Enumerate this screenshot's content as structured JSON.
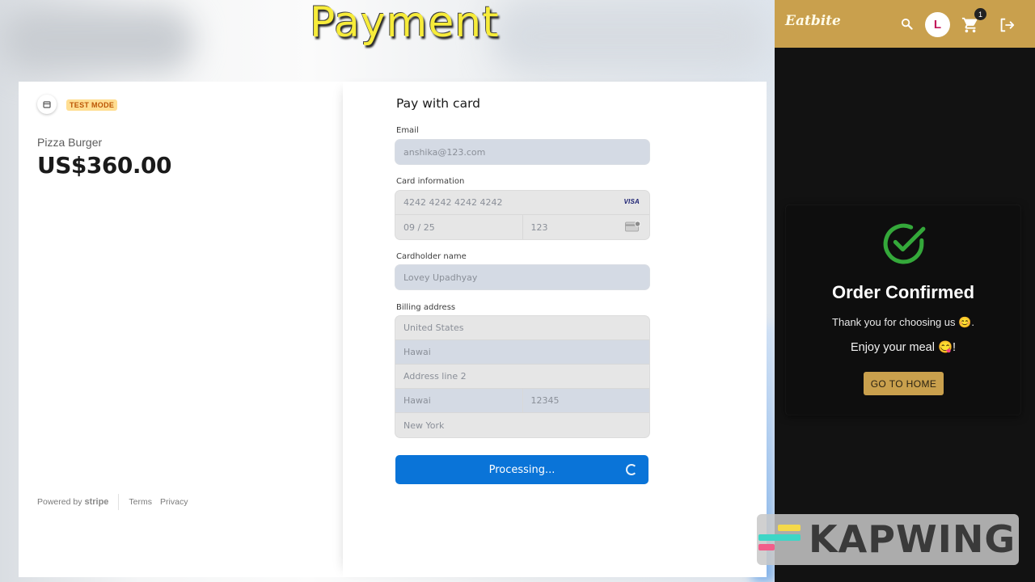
{
  "overlay": {
    "title": "Payment"
  },
  "checkout": {
    "test_mode": "TEST MODE",
    "product_name": "Pizza Burger",
    "price": "US$360.00",
    "footer": {
      "powered_by": "Powered by",
      "stripe": "stripe",
      "terms": "Terms",
      "privacy": "Privacy"
    }
  },
  "form": {
    "title": "Pay with card",
    "email_label": "Email",
    "email_value": "anshika@123.com",
    "card_label": "Card information",
    "card_number": "4242 4242 4242 4242",
    "card_brand": "VISA",
    "expiry": "09 / 25",
    "cvc": "123",
    "cardholder_label": "Cardholder name",
    "cardholder_value": "Lovey Upadhyay",
    "billing_label": "Billing address",
    "country": "United States",
    "address_line1": "Hawai",
    "address_line2": "Address line 2",
    "city": "Hawai",
    "zip": "12345",
    "state": "New York",
    "submit_label": "Processing..."
  },
  "app": {
    "brand": "Eatbite",
    "avatar_initial": "L",
    "cart_count": "1",
    "confirm_title": "Order Confirmed",
    "confirm_msg1": "Thank you for choosing us 😊.",
    "confirm_msg2": "Enjoy your meal 😋!",
    "home_button": "GO TO HOME",
    "accent_color": "#c9a04d",
    "check_color": "#34a83a"
  },
  "watermark": {
    "text": "KAPWING"
  }
}
